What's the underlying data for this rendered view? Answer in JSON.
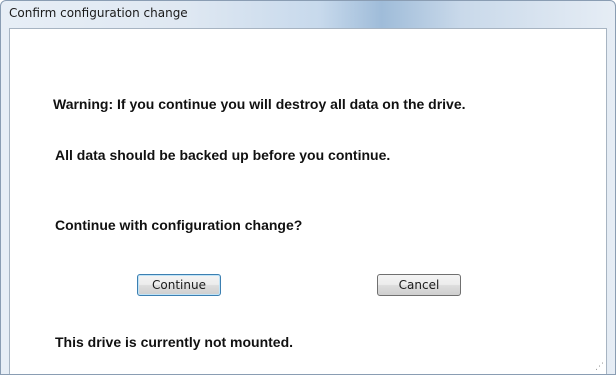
{
  "window": {
    "title": "Confirm configuration change"
  },
  "dialog": {
    "warning_text": "Warning: If you continue you will destroy all data on the drive.",
    "backup_text": "All data should be backed up before you continue.",
    "question_text": "Continue with configuration change?",
    "status_text": "This drive is currently not mounted.",
    "continue_label": "Continue",
    "cancel_label": "Cancel"
  },
  "icons": {
    "resize_grip": "resize-grip-icon"
  },
  "colors": {
    "default_button_border": "#3c7fb1",
    "title_bar_accent": "#9fbcd9"
  }
}
